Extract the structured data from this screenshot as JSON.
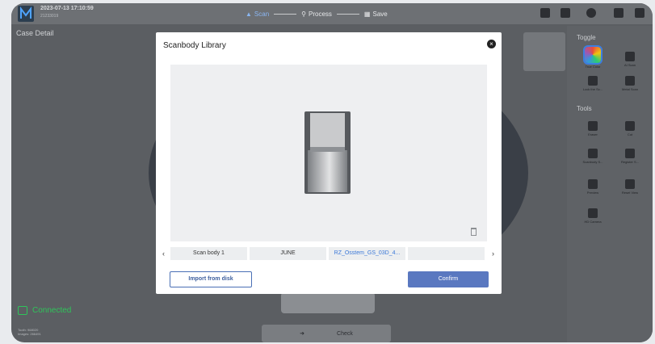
{
  "topbar": {
    "datetime": "2023-07-13 17:10:59",
    "subtitle": "21233019",
    "steps": [
      {
        "label": "Scan",
        "icon": "scan-icon",
        "active": true
      },
      {
        "label": "Process",
        "icon": "search-icon",
        "active": false
      },
      {
        "label": "Save",
        "icon": "save-icon",
        "active": false
      }
    ]
  },
  "main": {
    "case_title": "Case Detail",
    "connection": "Connected",
    "info_lines": [
      "Tooth: 968020",
      "Images: 266491"
    ],
    "check_label": "Check"
  },
  "right_panel": {
    "toggle_title": "Toggle",
    "tools_title": "Tools",
    "toggle_items": [
      "True Color",
      "AI Scan",
      "Lock the Sc...",
      "Metal Scan"
    ],
    "tool_items": [
      "Eraser",
      "Cut",
      "Scanbody S...",
      "Register S...",
      "Preview",
      "Reset View",
      "HD Camera"
    ]
  },
  "modal": {
    "title": "Scanbody Library",
    "library_items": [
      {
        "label": "Scan body 1",
        "selected": false
      },
      {
        "label": "JUNE",
        "selected": false
      },
      {
        "label": "RZ_Osstem_GS_03D_4...",
        "selected": true
      },
      {
        "label": "",
        "selected": false
      }
    ],
    "import_label": "Import from disk",
    "confirm_label": "Confirm"
  },
  "colors": {
    "accent": "#5a78c0",
    "connected": "#2fc45a",
    "selected_text": "#3b78d8"
  }
}
